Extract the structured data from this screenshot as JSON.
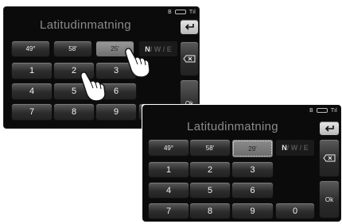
{
  "status": {
    "bt": "B",
    "signal": "Tıl"
  },
  "title": "Latitudinmatning",
  "fields": {
    "deg": "49°",
    "min": "58'",
    "sec_typing": "25'",
    "sec": "29'"
  },
  "dir": {
    "n": "N",
    "rest": "/ W / E"
  },
  "digits": [
    "1",
    "2",
    "3",
    "4",
    "5",
    "6",
    "7",
    "8",
    "9",
    "0"
  ],
  "buttons": {
    "ok": "Ok"
  },
  "icons": {
    "back": "return-arrow-icon",
    "backspace": "backspace-x-icon",
    "hand": "pointing-hand-icon"
  }
}
